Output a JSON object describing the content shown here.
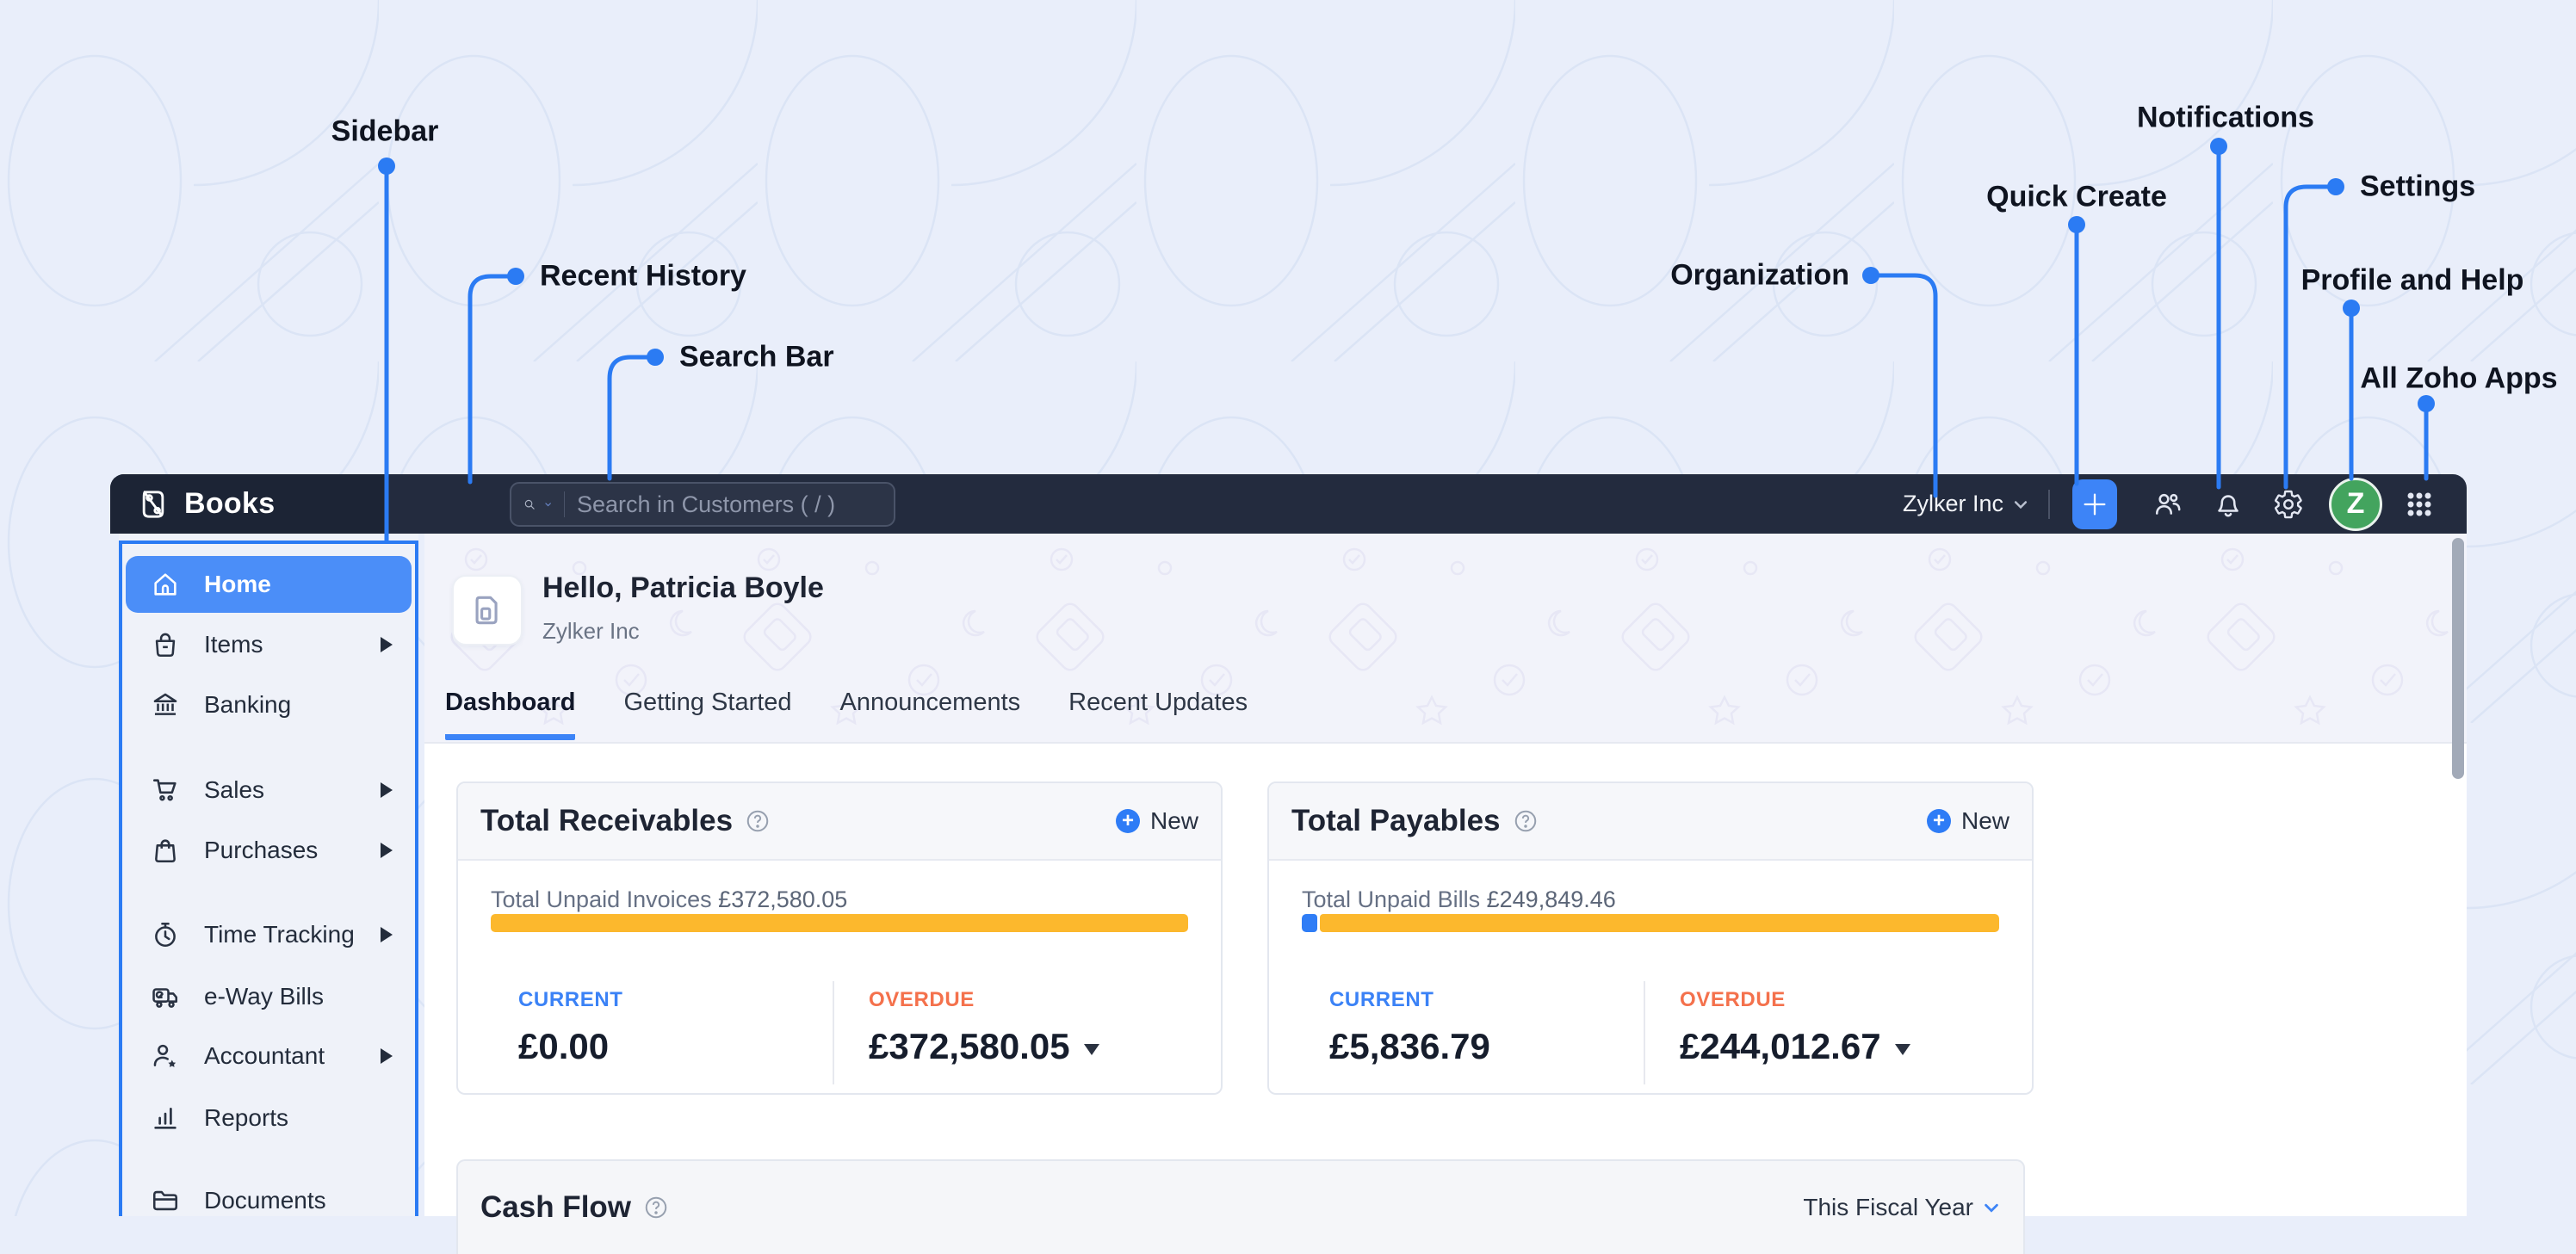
{
  "annotations": {
    "sidebar": "Sidebar",
    "recent_history": "Recent History",
    "search_bar": "Search Bar",
    "organization": "Organization",
    "quick_create": "Quick Create",
    "notifications": "Notifications",
    "settings": "Settings",
    "profile_and_help": "Profile and Help",
    "all_zoho_apps": "All Zoho Apps"
  },
  "topbar": {
    "product_name": "Books",
    "search_placeholder": "Search in Customers ( / )",
    "organization_name": "Zylker Inc",
    "avatar_initial": "Z",
    "quick_create_glyph": "+"
  },
  "sidebar": {
    "items": [
      {
        "label": "Home",
        "active": true,
        "has_submenu": false
      },
      {
        "label": "Items",
        "active": false,
        "has_submenu": true
      },
      {
        "label": "Banking",
        "active": false,
        "has_submenu": false
      },
      {
        "label": "Sales",
        "active": false,
        "has_submenu": true
      },
      {
        "label": "Purchases",
        "active": false,
        "has_submenu": true
      },
      {
        "label": "Time Tracking",
        "active": false,
        "has_submenu": true
      },
      {
        "label": "e-Way Bills",
        "active": false,
        "has_submenu": false
      },
      {
        "label": "Accountant",
        "active": false,
        "has_submenu": true
      },
      {
        "label": "Reports",
        "active": false,
        "has_submenu": false
      },
      {
        "label": "Documents",
        "active": false,
        "has_submenu": false
      }
    ]
  },
  "header": {
    "greeting": "Hello, Patricia Boyle",
    "org": "Zylker Inc",
    "tabs": [
      {
        "label": "Dashboard",
        "active": true
      },
      {
        "label": "Getting Started",
        "active": false
      },
      {
        "label": "Announcements",
        "active": false
      },
      {
        "label": "Recent Updates",
        "active": false
      }
    ]
  },
  "receivables": {
    "title": "Total Receivables",
    "new_label": "New",
    "summary_label": "Total Unpaid Invoices",
    "summary_value": "£372,580.05",
    "current_label": "CURRENT",
    "current_value": "£0.00",
    "overdue_label": "OVERDUE",
    "overdue_value": "£372,580.05",
    "bar": {
      "current_pct": 0,
      "overdue_pct": 100
    }
  },
  "payables": {
    "title": "Total Payables",
    "new_label": "New",
    "summary_label": "Total Unpaid Bills",
    "summary_value": "£249,849.46",
    "current_label": "CURRENT",
    "current_value": "£5,836.79",
    "overdue_label": "OVERDUE",
    "overdue_value": "£244,012.67",
    "bar": {
      "current_pct": 2.2,
      "overdue_pct": 97.8
    }
  },
  "cashflow": {
    "title": "Cash Flow",
    "filter_value": "This Fiscal Year"
  },
  "colors": {
    "annotation_blue": "#2B7BF3",
    "navbar": "#232B3E",
    "active_item_blue": "#4B8EF8",
    "amber_bar": "#FCB82D",
    "current_blue": "#3B82F6",
    "overdue_orange": "#F4714C",
    "avatar_green": "#43A45E"
  }
}
